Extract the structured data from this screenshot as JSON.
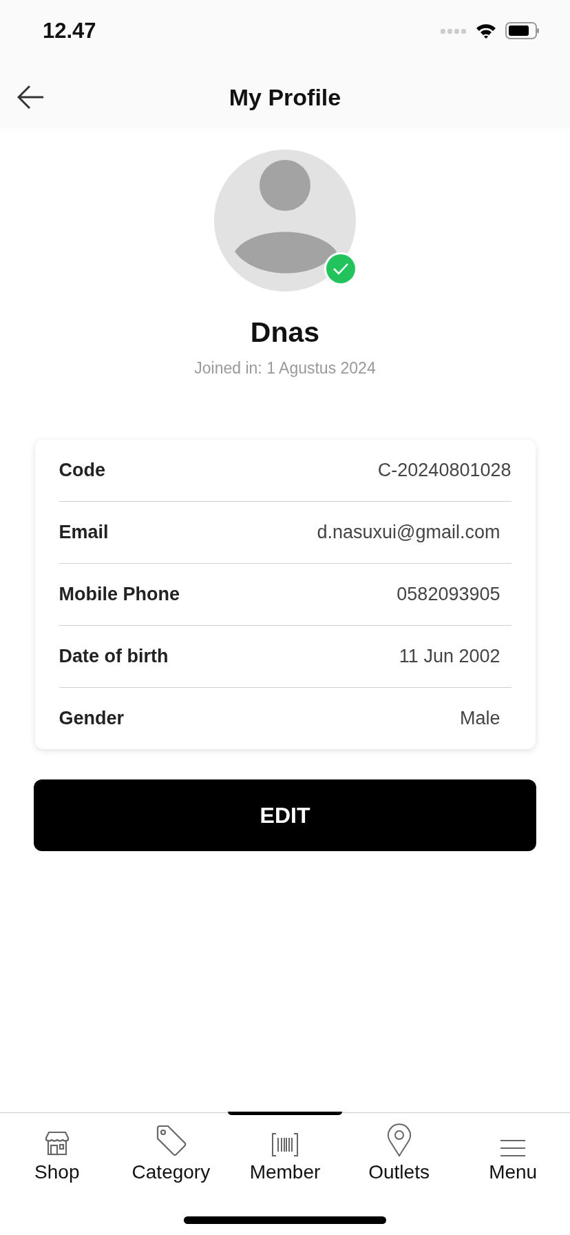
{
  "status_bar": {
    "time": "12.47"
  },
  "header": {
    "title": "My Profile"
  },
  "profile": {
    "name": "Dnas",
    "joined": "Joined in: 1 Agustus 2024",
    "verified": true
  },
  "details": [
    {
      "label": "Code",
      "value": "C-20240801028"
    },
    {
      "label": "Email",
      "value": "d.nasuxui@gmail.com"
    },
    {
      "label": "Mobile Phone",
      "value": "0582093905"
    },
    {
      "label": "Date of birth",
      "value": "11 Jun 2002"
    },
    {
      "label": "Gender",
      "value": "Male"
    }
  ],
  "edit_button": {
    "label": "EDIT"
  },
  "tab_bar": [
    {
      "kind": "shop",
      "label": "Shop",
      "selected": false
    },
    {
      "kind": "category",
      "label": "Category",
      "selected": false
    },
    {
      "kind": "member",
      "label": "Member",
      "selected": true
    },
    {
      "kind": "outlets",
      "label": "Outlets",
      "selected": false
    },
    {
      "kind": "menu",
      "label": "Menu",
      "selected": false
    }
  ]
}
